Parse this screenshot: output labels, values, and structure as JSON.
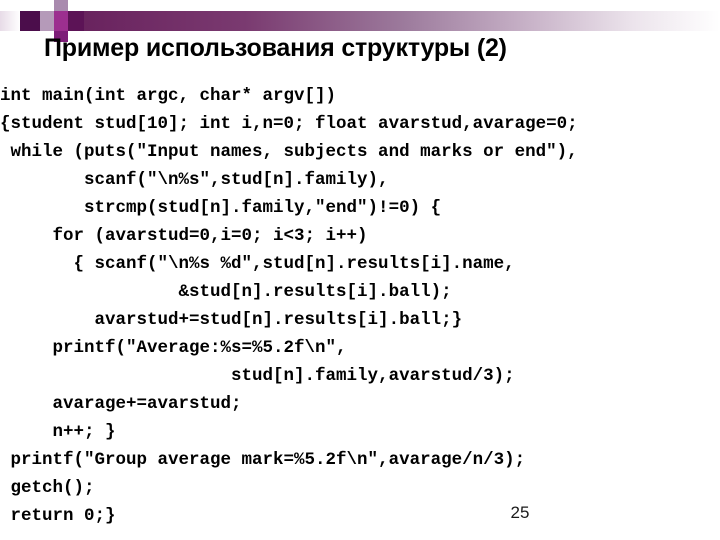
{
  "slide": {
    "title": "Пример использования структуры (2)",
    "page_number": "25",
    "decor": {
      "bar_dark": "#5c1f55",
      "bar_mid": "#9c7a9c",
      "bar_light": "#ffffff",
      "square_dark": "#4b0d4b",
      "square_magenta": "#9c2f8f",
      "square_lilac": "#b59ab9",
      "square_plum": "#7d1d78"
    },
    "code": {
      "language": "c",
      "lines": [
        "int main(int argc, char* argv[])",
        "{student stud[10]; int i,n=0; float avarstud,avarage=0;",
        " while (puts(\"Input names, subjects and marks or end\"),",
        "        scanf(\"\\n%s\",stud[n].family),",
        "        strcmp(stud[n].family,\"end\")!=0) {",
        "     for (avarstud=0,i=0; i<3; i++)",
        "       { scanf(\"\\n%s %d\",stud[n].results[i].name,",
        "                 &stud[n].results[i].ball);",
        "         avarstud+=stud[n].results[i].ball;}",
        "     printf(\"Average:%s=%5.2f\\n\",",
        "                      stud[n].family,avarstud/3);",
        "     avarage+=avarstud;",
        "     n++; }",
        " printf(\"Group average mark=%5.2f\\n\",avarage/n/3);",
        " getch();",
        " return 0;}"
      ]
    }
  }
}
